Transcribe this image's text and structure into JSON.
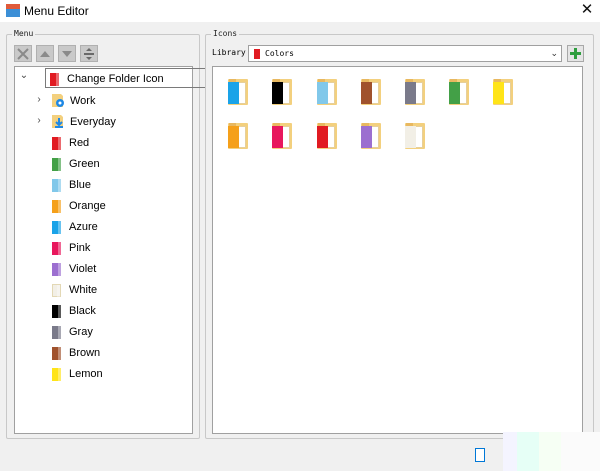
{
  "window": {
    "title": "Menu Editor",
    "close_glyph": "✕"
  },
  "menu_panel": {
    "legend": "Menu",
    "toolbar": [
      {
        "name": "delete-button",
        "icon": "x-icon"
      },
      {
        "name": "move-up-button",
        "icon": "arrow-up-icon"
      },
      {
        "name": "move-down-button",
        "icon": "arrow-down-icon"
      },
      {
        "name": "separator-button",
        "icon": "separator-icon"
      }
    ],
    "root": {
      "label": "Change Folder Icon",
      "color": "#e11b22",
      "expander": "⌄"
    },
    "items": [
      {
        "label": "Work",
        "expander": "›",
        "color": "#1e88e5"
      },
      {
        "label": "Everyday",
        "expander": "›",
        "color": "#1e88e5"
      },
      {
        "label": "Red",
        "color": "#e11b22"
      },
      {
        "label": "Green",
        "color": "#43a047"
      },
      {
        "label": "Blue",
        "color": "#81c8ea"
      },
      {
        "label": "Orange",
        "color": "#f5a01a"
      },
      {
        "label": "Azure",
        "color": "#1aa3e8"
      },
      {
        "label": "Pink",
        "color": "#e8175d"
      },
      {
        "label": "Violet",
        "color": "#9c6fd0"
      },
      {
        "label": "White",
        "color": "#f2efe6"
      },
      {
        "label": "Black",
        "color": "#000000"
      },
      {
        "label": "Gray",
        "color": "#7a7a8a"
      },
      {
        "label": "Brown",
        "color": "#a0522d"
      },
      {
        "label": "Lemon",
        "color": "#ffe418"
      }
    ]
  },
  "icons_panel": {
    "legend": "Icons",
    "library_label": "Library",
    "library_value": "Colors",
    "library_color": "#e11b22",
    "add_glyph": "+",
    "icons": [
      {
        "name": "azure",
        "color": "#1aa3e8"
      },
      {
        "name": "black",
        "color": "#000000"
      },
      {
        "name": "blue",
        "color": "#81c8ea"
      },
      {
        "name": "brown",
        "color": "#a0522d"
      },
      {
        "name": "gray",
        "color": "#7a7a8a"
      },
      {
        "name": "green",
        "color": "#43a047"
      },
      {
        "name": "lemon",
        "color": "#ffe418"
      },
      {
        "name": "orange",
        "color": "#f5a01a"
      },
      {
        "name": "pink",
        "color": "#e8175d"
      },
      {
        "name": "red",
        "color": "#e11b22"
      },
      {
        "name": "violet",
        "color": "#9c6fd0"
      },
      {
        "name": "white",
        "color": "#f2efe6"
      }
    ]
  }
}
